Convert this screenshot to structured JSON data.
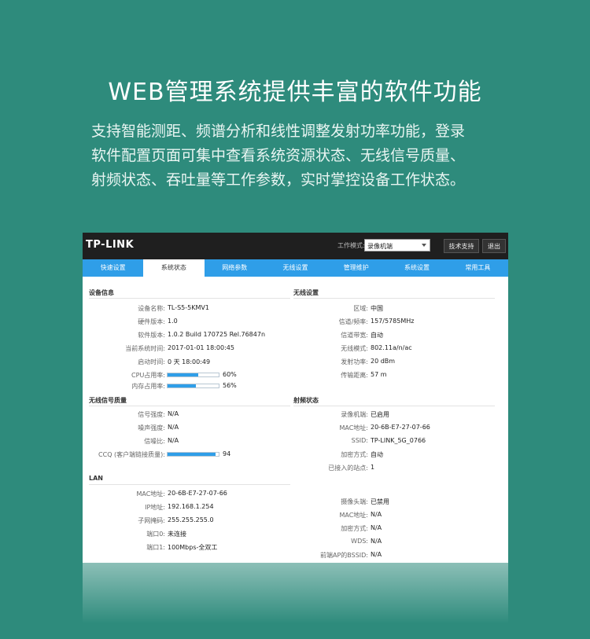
{
  "hero": {
    "title": "WEB管理系统提供丰富的软件功能",
    "desc_lines": [
      "支持智能测距、频谱分析和线性调整发射功率功能，登录",
      "软件配置页面可集中查看系统资源状态、无线信号质量、",
      "射频状态、吞吐量等工作参数，实时掌控设备工作状态。"
    ]
  },
  "ui": {
    "logo": "TP-LINK",
    "mode_label": "工作模式:",
    "mode_value": "录像机端",
    "support_btn": "技术支持",
    "logout_btn": "退出",
    "tabs": [
      "快速设置",
      "系统状态",
      "网络参数",
      "无线设置",
      "管理维护",
      "系统设置",
      "常用工具"
    ],
    "active_tab": "系统状态",
    "device": {
      "title": "设备信息",
      "rows": [
        {
          "label": "设备名称:",
          "value": "TL-S5-5KMV1"
        },
        {
          "label": "硬件版本:",
          "value": "1.0"
        },
        {
          "label": "软件版本:",
          "value": "1.0.2 Build 170725 Rel.76847n"
        },
        {
          "label": "当前系统时间:",
          "value": "2017-01-01 18:00:45"
        },
        {
          "label": "启动时间:",
          "value": "0 天 18:00:49"
        }
      ],
      "cpu_label": "CPU占用率:",
      "cpu_value": "60%",
      "cpu": 0.6,
      "mem_label": "内存占用率:",
      "mem_value": "56%",
      "mem": 0.56
    },
    "signal": {
      "title": "无线信号质量",
      "rows": [
        {
          "label": "信号强度:",
          "value": "N/A"
        },
        {
          "label": "噪声强度:",
          "value": "N/A"
        },
        {
          "label": "信噪比:",
          "value": "N/A"
        }
      ],
      "ccq_label": "CCQ (客户端链接质量):",
      "ccq_value": "94",
      "ccq": 0.94
    },
    "lan": {
      "title": "LAN",
      "rows": [
        {
          "label": "MAC地址:",
          "value": "20-6B-E7-27-07-66"
        },
        {
          "label": "IP地址:",
          "value": "192.168.1.254"
        },
        {
          "label": "子网掩码:",
          "value": "255.255.255.0"
        },
        {
          "label": "端口0:",
          "value": "未连接"
        },
        {
          "label": "端口1:",
          "value": "100Mbps-全双工"
        }
      ]
    },
    "wireless": {
      "title": "无线设置",
      "rows": [
        {
          "label": "区域:",
          "value": "中国"
        },
        {
          "label": "信道/频率:",
          "value": "157/5785MHz"
        },
        {
          "label": "信道带宽:",
          "value": "自动"
        },
        {
          "label": "无线模式:",
          "value": "802.11a/n/ac"
        },
        {
          "label": "发射功率:",
          "value": "20 dBm"
        },
        {
          "label": "传输距离:",
          "value": "57 m"
        }
      ]
    },
    "radio": {
      "title": "射频状态",
      "rows": [
        {
          "label": "录像机端:",
          "value": "已启用"
        },
        {
          "label": "MAC地址:",
          "value": "20-6B-E7-27-07-66"
        },
        {
          "label": "SSID:",
          "value": "TP-LINK_5G_0766"
        },
        {
          "label": "加密方式:",
          "value": "自动"
        },
        {
          "label": "已接入的站点:",
          "value": "1"
        }
      ],
      "rows2": [
        {
          "label": "摄像头端:",
          "value": "已禁用"
        },
        {
          "label": "MAC地址:",
          "value": "N/A"
        },
        {
          "label": "加密方式:",
          "value": "N/A"
        },
        {
          "label": "WDS:",
          "value": "N/A"
        },
        {
          "label": "前端AP的BSSID:",
          "value": "N/A"
        }
      ]
    }
  }
}
